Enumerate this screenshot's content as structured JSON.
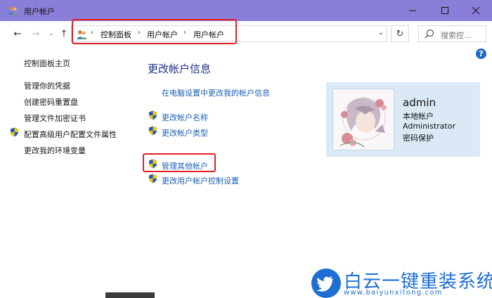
{
  "window": {
    "title": "用户帐户",
    "icon": "user-accounts-icon"
  },
  "address_bar": {
    "breadcrumbs": [
      "控制面板",
      "用户帐户",
      "用户帐户"
    ],
    "search_placeholder": "搜索控..."
  },
  "left_nav": {
    "home": "控制面板主页",
    "items": [
      {
        "label": "管理你的凭据",
        "shield": false
      },
      {
        "label": "创建密码重置盘",
        "shield": false
      },
      {
        "label": "管理文件加密证书",
        "shield": false
      },
      {
        "label": "配置高级用户配置文件属性",
        "shield": true
      },
      {
        "label": "更改我的环境变量",
        "shield": false
      }
    ]
  },
  "main": {
    "title": "更改帐户信息",
    "pc_settings_link": "在电脑设置中更改我的帐户信息",
    "actions": [
      {
        "label": "更改帐户名称",
        "shield": true
      },
      {
        "label": "更改帐户类型",
        "shield": true
      }
    ],
    "manage_other": "管理其他帐户",
    "uac": "更改用户帐户控制设置"
  },
  "account": {
    "name": "admin",
    "type": "本地帐户",
    "role": "Administrator",
    "password": "密码保护"
  },
  "watermark": {
    "title": "白云一键重装系统",
    "url": "www.baiyunxitong.com"
  },
  "colors": {
    "titlebar": "#8a7fd8",
    "link": "#1a5fb4",
    "heading": "#1e3287",
    "highlight": "#e21f26",
    "card": "#dbe9f7"
  }
}
